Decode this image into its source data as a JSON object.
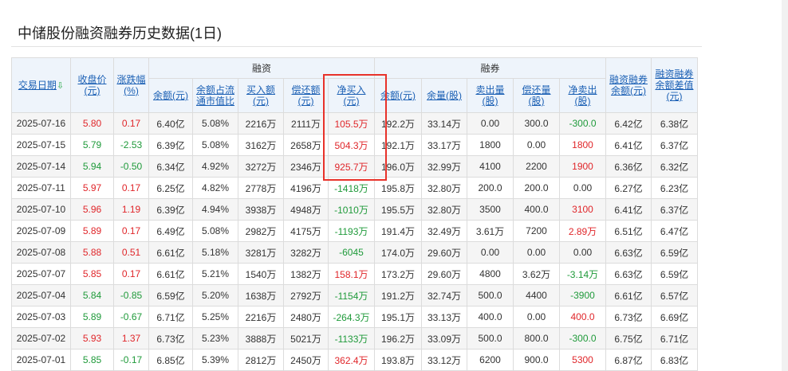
{
  "page_title": "中储股份融资融券历史数据(1日)",
  "header": {
    "date": "交易日期",
    "date_arrow": "⇩",
    "close": [
      "收盘价",
      "(元)"
    ],
    "change": [
      "涨跌幅",
      "(%)"
    ],
    "margin_group": "融资",
    "short_group": "融券",
    "margin_balance": "余额(元)",
    "margin_ratio": [
      "余额占流",
      "通市值比"
    ],
    "buy_amount": [
      "买入额",
      "(元)"
    ],
    "repay_amount": [
      "偿还额",
      "(元)"
    ],
    "net_buy": [
      "净买入",
      "(元)"
    ],
    "short_balance": "余额(元)",
    "short_volume": "余量(股)",
    "sell_volume": [
      "卖出量",
      "(股)"
    ],
    "short_repay": [
      "偿还量",
      "(股)"
    ],
    "net_sell": [
      "净卖出",
      "(股)"
    ],
    "total_balance": [
      "融资融券",
      "余额(元)"
    ],
    "diff_balance": [
      "融资融券",
      "余额差值",
      "(元)"
    ]
  },
  "rows": [
    {
      "date": "2025-07-16",
      "close": "5.80",
      "change": "0.17",
      "mbal": "6.40亿",
      "ratio": "5.08%",
      "buy": "2216万",
      "repay": "2111万",
      "net": "105.5万",
      "sbal": "192.2万",
      "svol": "33.14万",
      "sell": "0.00",
      "srep": "300.0",
      "nsell": "-300.0",
      "total": "6.42亿",
      "diff": "6.38亿"
    },
    {
      "date": "2025-07-15",
      "close": "5.79",
      "change": "-2.53",
      "mbal": "6.39亿",
      "ratio": "5.08%",
      "buy": "3162万",
      "repay": "2658万",
      "net": "504.3万",
      "sbal": "192.1万",
      "svol": "33.17万",
      "sell": "1800",
      "srep": "0.00",
      "nsell": "1800",
      "total": "6.41亿",
      "diff": "6.37亿"
    },
    {
      "date": "2025-07-14",
      "close": "5.94",
      "change": "-0.50",
      "mbal": "6.34亿",
      "ratio": "4.92%",
      "buy": "3272万",
      "repay": "2346万",
      "net": "925.7万",
      "sbal": "196.0万",
      "svol": "32.99万",
      "sell": "4100",
      "srep": "2200",
      "nsell": "1900",
      "total": "6.36亿",
      "diff": "6.32亿"
    },
    {
      "date": "2025-07-11",
      "close": "5.97",
      "change": "0.17",
      "mbal": "6.25亿",
      "ratio": "4.82%",
      "buy": "2778万",
      "repay": "4196万",
      "net": "-1418万",
      "sbal": "195.8万",
      "svol": "32.80万",
      "sell": "200.0",
      "srep": "200.0",
      "nsell": "0.00",
      "total": "6.27亿",
      "diff": "6.23亿"
    },
    {
      "date": "2025-07-10",
      "close": "5.96",
      "change": "1.19",
      "mbal": "6.39亿",
      "ratio": "4.94%",
      "buy": "3938万",
      "repay": "4948万",
      "net": "-1010万",
      "sbal": "195.5万",
      "svol": "32.80万",
      "sell": "3500",
      "srep": "400.0",
      "nsell": "3100",
      "total": "6.41亿",
      "diff": "6.37亿"
    },
    {
      "date": "2025-07-09",
      "close": "5.89",
      "change": "0.17",
      "mbal": "6.49亿",
      "ratio": "5.08%",
      "buy": "2982万",
      "repay": "4175万",
      "net": "-1193万",
      "sbal": "191.4万",
      "svol": "32.49万",
      "sell": "3.61万",
      "srep": "7200",
      "nsell": "2.89万",
      "total": "6.51亿",
      "diff": "6.47亿"
    },
    {
      "date": "2025-07-08",
      "close": "5.88",
      "change": "0.51",
      "mbal": "6.61亿",
      "ratio": "5.18%",
      "buy": "3281万",
      "repay": "3282万",
      "net": "-6045",
      "sbal": "174.0万",
      "svol": "29.60万",
      "sell": "0.00",
      "srep": "0.00",
      "nsell": "0.00",
      "total": "6.63亿",
      "diff": "6.59亿"
    },
    {
      "date": "2025-07-07",
      "close": "5.85",
      "change": "0.17",
      "mbal": "6.61亿",
      "ratio": "5.21%",
      "buy": "1540万",
      "repay": "1382万",
      "net": "158.1万",
      "sbal": "173.2万",
      "svol": "29.60万",
      "sell": "4800",
      "srep": "3.62万",
      "nsell": "-3.14万",
      "total": "6.63亿",
      "diff": "6.59亿"
    },
    {
      "date": "2025-07-04",
      "close": "5.84",
      "change": "-0.85",
      "mbal": "6.59亿",
      "ratio": "5.20%",
      "buy": "1638万",
      "repay": "2792万",
      "net": "-1154万",
      "sbal": "191.2万",
      "svol": "32.74万",
      "sell": "500.0",
      "srep": "4400",
      "nsell": "-3900",
      "total": "6.61亿",
      "diff": "6.57亿"
    },
    {
      "date": "2025-07-03",
      "close": "5.89",
      "change": "-0.67",
      "mbal": "6.71亿",
      "ratio": "5.25%",
      "buy": "2216万",
      "repay": "2480万",
      "net": "-264.3万",
      "sbal": "195.1万",
      "svol": "33.13万",
      "sell": "400.0",
      "srep": "0.00",
      "nsell": "400.0",
      "total": "6.73亿",
      "diff": "6.69亿"
    },
    {
      "date": "2025-07-02",
      "close": "5.93",
      "change": "1.37",
      "mbal": "6.73亿",
      "ratio": "5.23%",
      "buy": "3888万",
      "repay": "5021万",
      "net": "-1133万",
      "sbal": "196.2万",
      "svol": "33.09万",
      "sell": "500.0",
      "srep": "800.0",
      "nsell": "-300.0",
      "total": "6.75亿",
      "diff": "6.71亿"
    },
    {
      "date": "2025-07-01",
      "close": "5.85",
      "change": "-0.17",
      "mbal": "6.85亿",
      "ratio": "5.39%",
      "buy": "2812万",
      "repay": "2450万",
      "net": "362.4万",
      "sbal": "193.8万",
      "svol": "33.12万",
      "sell": "6200",
      "srep": "900.0",
      "nsell": "5300",
      "total": "6.87亿",
      "diff": "6.83亿"
    }
  ],
  "colors": {
    "up": "#e0262a",
    "down": "#1f9a3a",
    "link": "#1a5fb4",
    "highlight": "#e8322a"
  }
}
